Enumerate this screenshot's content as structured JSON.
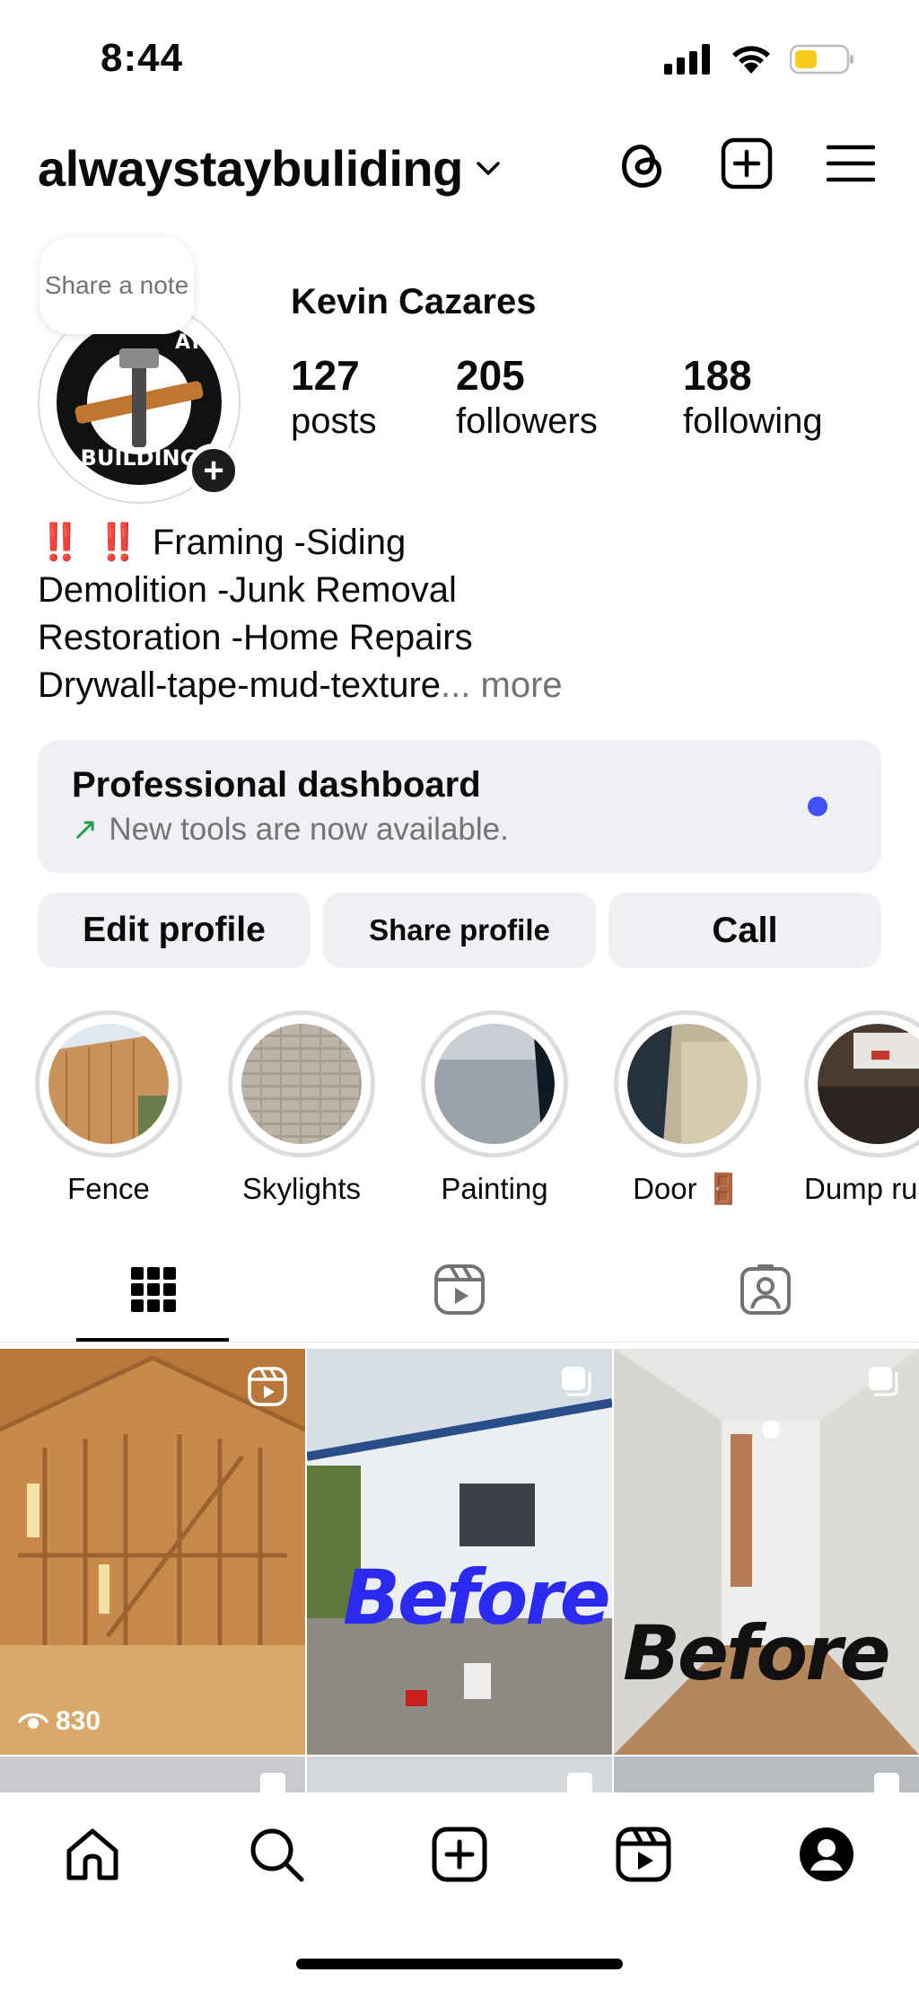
{
  "status_bar": {
    "time": "8:44"
  },
  "header": {
    "username": "alwaystaybuliding"
  },
  "profile": {
    "note_text": "Share a note",
    "full_name": "Kevin Cazares",
    "stats": [
      {
        "value": "127",
        "label": "posts"
      },
      {
        "value": "205",
        "label": "followers"
      },
      {
        "value": "188",
        "label": "following"
      }
    ],
    "bio_emoji": "‼️ ‼️",
    "bio_lines": [
      "Framing -Siding",
      "Demolition -Junk Removal",
      "Restoration -Home Repairs",
      "Drywall-tape-mud-texture"
    ],
    "bio_ellipsis": "...",
    "bio_more": "more"
  },
  "dashboard": {
    "title": "Professional dashboard",
    "arrow": "↗",
    "subtitle": "New tools are now available.",
    "dot_color": "#4150f7"
  },
  "buttons": {
    "edit": "Edit profile",
    "share": "Share profile",
    "call": "Call"
  },
  "highlights": [
    {
      "label": "Fence"
    },
    {
      "label": "Skylights"
    },
    {
      "label": "Painting"
    },
    {
      "label": "Door 🚪"
    },
    {
      "label": "Dump ru"
    }
  ],
  "grid": {
    "posts": [
      {
        "views": "830"
      },
      {
        "overlay_text": "Before",
        "overlay_color": "#2a2af0"
      },
      {
        "overlay_text": "Before",
        "overlay_color": "#111111"
      }
    ]
  },
  "tabs": {
    "active": "posts-grid"
  },
  "colors": {
    "accent_blue": "#4150f7",
    "button_bg": "#efeff4",
    "battery_yellow": "#f6cc1b"
  }
}
